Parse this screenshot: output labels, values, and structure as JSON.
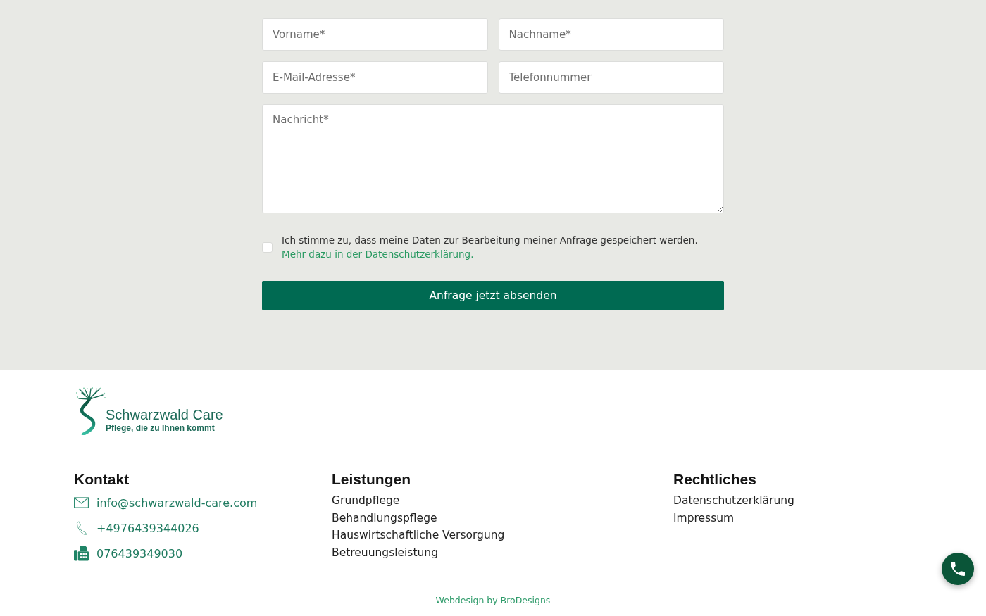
{
  "contact_form": {
    "fields": [
      {
        "placeholder": "Vorname*"
      },
      {
        "placeholder": "Nachname*"
      },
      {
        "placeholder": "E-Mail-Adresse*"
      },
      {
        "placeholder": "Telefonnummer"
      }
    ],
    "message": {
      "placeholder": "Nachricht*"
    },
    "consent": {
      "checked": false,
      "text": "Ich stimme zu, dass meine Daten zur Bearbeitung meiner Anfrage gespeichert werden.",
      "link": "Mehr dazu in der Datenschutzerklärung."
    },
    "submit_button": "Anfrage jetzt absenden"
  },
  "footer": {
    "logo": {
      "name": "Schwarzwald Care",
      "tagline": "Pflege, die zu Ihnen kommt"
    },
    "contact": {
      "heading": "Kontakt",
      "items": [
        {
          "kind": "email",
          "text": "info@schwarzwald-care.com"
        },
        {
          "kind": "phone",
          "text": "+4976439344026"
        },
        {
          "kind": "fax",
          "text": "076439349030"
        }
      ]
    },
    "services": {
      "heading": "Leistungen",
      "links": [
        "Grundpflege",
        "Behandlungspflege",
        "Hauswirtschaftliche Versorgung",
        "Betreuungsleistung"
      ]
    },
    "legal": {
      "heading": "Rechtliches",
      "links": [
        "Datenschutzerklärung",
        "Impressum"
      ]
    },
    "credit": "Webdesign by BroDesigns"
  }
}
